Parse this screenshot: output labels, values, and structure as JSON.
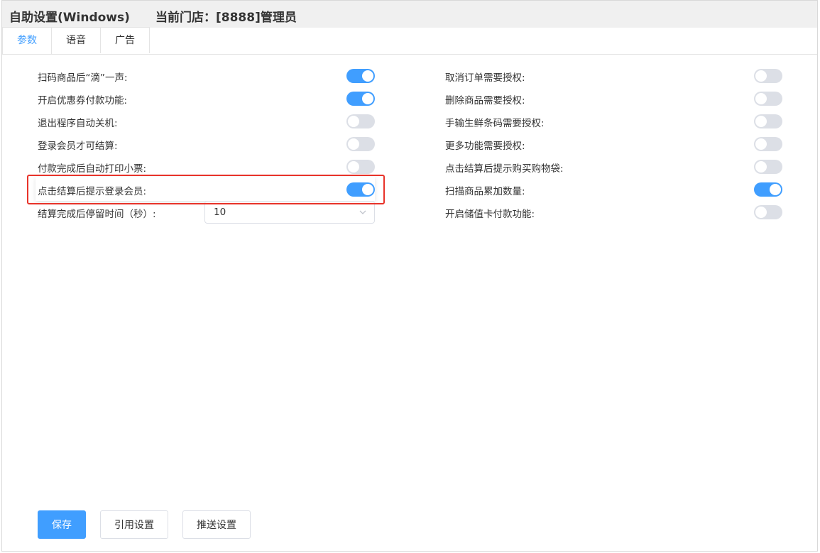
{
  "header": {
    "title": "自助设置(Windows)",
    "store": "当前门店：[8888]管理员"
  },
  "tabs": [
    {
      "label": "参数",
      "active": true
    },
    {
      "label": "语音",
      "active": false
    },
    {
      "label": "广告",
      "active": false
    }
  ],
  "left_settings": [
    {
      "label": "扫码商品后“滴”一声:",
      "on": true
    },
    {
      "label": "开启优惠券付款功能:",
      "on": true
    },
    {
      "label": "退出程序自动关机:",
      "on": false
    },
    {
      "label": "登录会员才可结算:",
      "on": false
    },
    {
      "label": "付款完成后自动打印小票:",
      "on": false
    },
    {
      "label": "点击结算后提示登录会员:",
      "on": true
    }
  ],
  "stay_time": {
    "label": "结算完成后停留时间（秒）:",
    "value": "10"
  },
  "right_settings": [
    {
      "label": "取消订单需要授权:",
      "on": false
    },
    {
      "label": "删除商品需要授权:",
      "on": false
    },
    {
      "label": "手输生鲜条码需要授权:",
      "on": false
    },
    {
      "label": "更多功能需要授权:",
      "on": false
    },
    {
      "label": "点击结算后提示购买购物袋:",
      "on": false
    },
    {
      "label": "扫描商品累加数量:",
      "on": true
    },
    {
      "label": "开启储值卡付款功能:",
      "on": false
    }
  ],
  "buttons": {
    "save": "保存",
    "reference": "引用设置",
    "push": "推送设置"
  },
  "colors": {
    "accent": "#409eff",
    "switch_off": "#dcdfe6",
    "highlight": "#e8332a"
  }
}
